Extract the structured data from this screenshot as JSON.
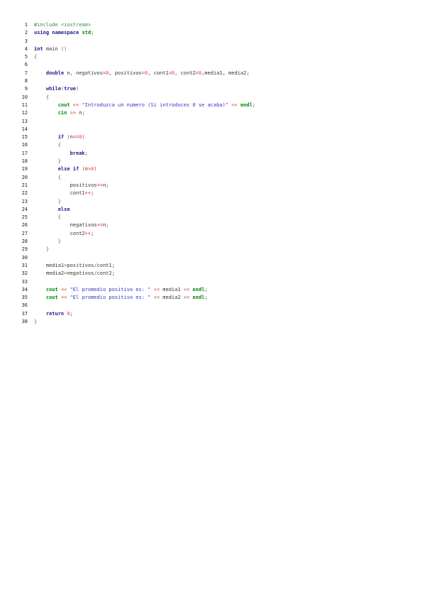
{
  "document": {
    "lines": [
      {
        "n": "1",
        "tokens": [
          [
            "pre",
            "#include <iostream>"
          ]
        ]
      },
      {
        "n": "2",
        "tokens": [
          [
            "kw",
            "using namespace"
          ],
          [
            "id",
            " "
          ],
          [
            "kw2",
            "std"
          ],
          [
            "id",
            ";"
          ]
        ]
      },
      {
        "n": "3",
        "tokens": []
      },
      {
        "n": "4",
        "tokens": [
          [
            "kw",
            "int"
          ],
          [
            "id",
            " main "
          ],
          [
            "op",
            "()"
          ]
        ]
      },
      {
        "n": "5",
        "tokens": [
          [
            "op",
            "{"
          ]
        ]
      },
      {
        "n": "6",
        "tokens": []
      },
      {
        "n": "7",
        "tokens": [
          [
            "id",
            "    "
          ],
          [
            "kw",
            "double"
          ],
          [
            "id",
            " n, negativos"
          ],
          [
            "op",
            "="
          ],
          [
            "num",
            "0"
          ],
          [
            "id",
            ", positivos"
          ],
          [
            "op",
            "="
          ],
          [
            "num",
            "0"
          ],
          [
            "id",
            ", cont1"
          ],
          [
            "op",
            "="
          ],
          [
            "num",
            "0"
          ],
          [
            "id",
            ", cont2"
          ],
          [
            "op",
            "="
          ],
          [
            "num",
            "0"
          ],
          [
            "id",
            ",media1, media2;"
          ]
        ]
      },
      {
        "n": "8",
        "tokens": []
      },
      {
        "n": "9",
        "tokens": [
          [
            "id",
            "    "
          ],
          [
            "kw",
            "while"
          ],
          [
            "op",
            "("
          ],
          [
            "kw",
            "true"
          ],
          [
            "op",
            ")"
          ]
        ]
      },
      {
        "n": "10",
        "tokens": [
          [
            "id",
            "    "
          ],
          [
            "op",
            "{"
          ]
        ]
      },
      {
        "n": "11",
        "tokens": [
          [
            "id",
            "        "
          ],
          [
            "kw2",
            "cout"
          ],
          [
            "id",
            " "
          ],
          [
            "op",
            "<<"
          ],
          [
            "id",
            " "
          ],
          [
            "str",
            "\"Introduzca un numero (Si introduces 0 se acaba)\""
          ],
          [
            "id",
            " "
          ],
          [
            "op",
            "<<"
          ],
          [
            "id",
            " "
          ],
          [
            "kw2",
            "endl"
          ],
          [
            "id",
            ";"
          ]
        ]
      },
      {
        "n": "12",
        "tokens": [
          [
            "id",
            "        "
          ],
          [
            "kw2",
            "cin"
          ],
          [
            "id",
            " "
          ],
          [
            "op",
            ">>"
          ],
          [
            "id",
            " n;"
          ]
        ]
      },
      {
        "n": "13",
        "tokens": []
      },
      {
        "n": "14",
        "tokens": []
      },
      {
        "n": "15",
        "tokens": [
          [
            "id",
            "        "
          ],
          [
            "kw",
            "if"
          ],
          [
            "id",
            " "
          ],
          [
            "op",
            "("
          ],
          [
            "id",
            "n"
          ],
          [
            "op",
            "=="
          ],
          [
            "num",
            "0"
          ],
          [
            "op",
            ")"
          ]
        ]
      },
      {
        "n": "16",
        "tokens": [
          [
            "id",
            "        "
          ],
          [
            "op",
            "{"
          ]
        ]
      },
      {
        "n": "17",
        "tokens": [
          [
            "id",
            "            "
          ],
          [
            "kw",
            "break"
          ],
          [
            "id",
            ";"
          ]
        ]
      },
      {
        "n": "18",
        "tokens": [
          [
            "id",
            "        "
          ],
          [
            "op",
            "}"
          ]
        ]
      },
      {
        "n": "19",
        "tokens": [
          [
            "id",
            "        "
          ],
          [
            "kw",
            "else if"
          ],
          [
            "id",
            " "
          ],
          [
            "op",
            "("
          ],
          [
            "id",
            "n"
          ],
          [
            "op",
            ">"
          ],
          [
            "num",
            "0"
          ],
          [
            "op",
            ")"
          ]
        ]
      },
      {
        "n": "20",
        "tokens": [
          [
            "id",
            "        "
          ],
          [
            "op",
            "{"
          ]
        ]
      },
      {
        "n": "21",
        "tokens": [
          [
            "id",
            "            positivos"
          ],
          [
            "op",
            "+="
          ],
          [
            "id",
            "n;"
          ]
        ]
      },
      {
        "n": "22",
        "tokens": [
          [
            "id",
            "            cont1"
          ],
          [
            "op",
            "++"
          ],
          [
            "id",
            ";"
          ]
        ]
      },
      {
        "n": "23",
        "tokens": [
          [
            "id",
            "        "
          ],
          [
            "op",
            "}"
          ]
        ]
      },
      {
        "n": "24",
        "tokens": [
          [
            "id",
            "        "
          ],
          [
            "kw",
            "else"
          ]
        ]
      },
      {
        "n": "25",
        "tokens": [
          [
            "id",
            "        "
          ],
          [
            "op",
            "{"
          ]
        ]
      },
      {
        "n": "26",
        "tokens": [
          [
            "id",
            "            negativos"
          ],
          [
            "op",
            "+="
          ],
          [
            "id",
            "n;"
          ]
        ]
      },
      {
        "n": "27",
        "tokens": [
          [
            "id",
            "            cont2"
          ],
          [
            "op",
            "++"
          ],
          [
            "id",
            ";"
          ]
        ]
      },
      {
        "n": "28",
        "tokens": [
          [
            "id",
            "        "
          ],
          [
            "op",
            "}"
          ]
        ]
      },
      {
        "n": "29",
        "tokens": [
          [
            "id",
            "    "
          ],
          [
            "op",
            "}"
          ]
        ]
      },
      {
        "n": "30",
        "tokens": []
      },
      {
        "n": "31",
        "tokens": [
          [
            "id",
            "    media1"
          ],
          [
            "op",
            "="
          ],
          [
            "id",
            "positivos"
          ],
          [
            "op",
            "/"
          ],
          [
            "id",
            "cont1;"
          ]
        ]
      },
      {
        "n": "32",
        "tokens": [
          [
            "id",
            "    media2"
          ],
          [
            "op",
            "="
          ],
          [
            "id",
            "negativos"
          ],
          [
            "op",
            "/"
          ],
          [
            "id",
            "cont2;"
          ]
        ]
      },
      {
        "n": "33",
        "tokens": []
      },
      {
        "n": "34",
        "tokens": [
          [
            "id",
            "    "
          ],
          [
            "kw2",
            "cout"
          ],
          [
            "id",
            " "
          ],
          [
            "op",
            "<<"
          ],
          [
            "id",
            " "
          ],
          [
            "str",
            "\"El promedio positivo es: \""
          ],
          [
            "id",
            " "
          ],
          [
            "op",
            "<<"
          ],
          [
            "id",
            " media1 "
          ],
          [
            "op",
            "<<"
          ],
          [
            "id",
            " "
          ],
          [
            "kw2",
            "endl"
          ],
          [
            "id",
            ";"
          ]
        ]
      },
      {
        "n": "35",
        "tokens": [
          [
            "id",
            "    "
          ],
          [
            "kw2",
            "cout"
          ],
          [
            "id",
            " "
          ],
          [
            "op",
            "<<"
          ],
          [
            "id",
            " "
          ],
          [
            "str",
            "\"El promedio positivo es: \""
          ],
          [
            "id",
            " "
          ],
          [
            "op",
            "<<"
          ],
          [
            "id",
            " media2 "
          ],
          [
            "op",
            "<<"
          ],
          [
            "id",
            " "
          ],
          [
            "kw2",
            "endl"
          ],
          [
            "id",
            ";"
          ]
        ]
      },
      {
        "n": "36",
        "tokens": []
      },
      {
        "n": "37",
        "tokens": [
          [
            "id",
            "    "
          ],
          [
            "kw",
            "return"
          ],
          [
            "id",
            " "
          ],
          [
            "num",
            "0"
          ],
          [
            "id",
            ";"
          ]
        ]
      },
      {
        "n": "38",
        "tokens": [
          [
            "op",
            "}"
          ]
        ]
      }
    ]
  },
  "colors": {
    "keyword": "#1a1a8c",
    "std_keyword": "#008800",
    "preprocessor": "#2e8b57",
    "string": "#3333cc",
    "number": "#ff3333",
    "operator": "#cc3333",
    "identifier": "#333333"
  }
}
